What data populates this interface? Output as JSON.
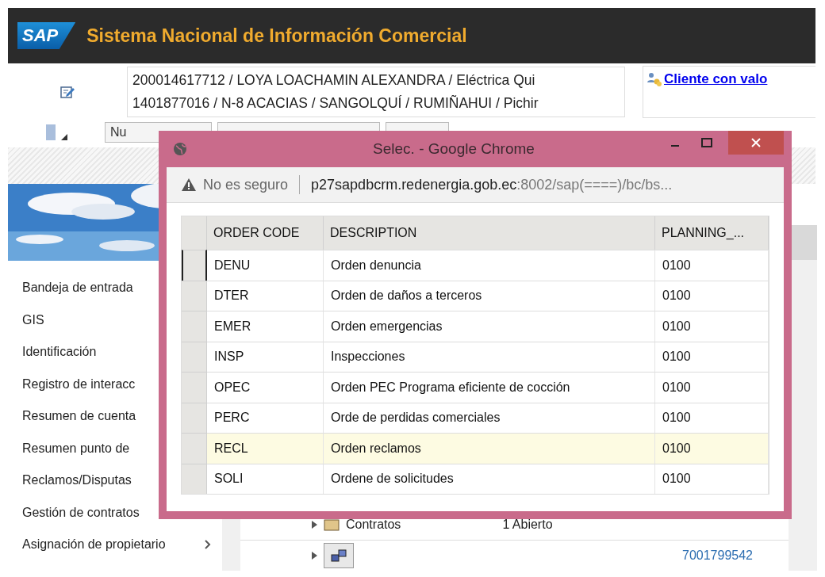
{
  "header": {
    "logo": "SAP",
    "title": "Sistema Nacional de Información Comercial"
  },
  "customer": {
    "lines": [
      "200014617712 / LOYA LOACHAMIN ALEXANDRA / Eléctrica Qui",
      "1401877016 / N-8 ACACIAS / SANGOLQUÍ / RUMIÑAHUI / Pichir"
    ],
    "link": "Cliente con valo"
  },
  "toolbar": {
    "field": "Nu"
  },
  "nav": {
    "items": [
      {
        "label": "Bandeja de entrada"
      },
      {
        "label": "GIS"
      },
      {
        "label": "Identificación"
      },
      {
        "label": "Registro de interacc"
      },
      {
        "label": "Resumen de cuenta"
      },
      {
        "label": "Resumen punto de"
      },
      {
        "label": "Reclamos/Disputas"
      },
      {
        "label": "Gestión de contratos"
      },
      {
        "label": "Asignación de propietario",
        "has_submenu": true
      }
    ]
  },
  "detail": {
    "rows": [
      {
        "kind": "folder",
        "label": "Contratos",
        "status": "1 Abierto"
      },
      {
        "kind": "object",
        "link": "7001799542"
      }
    ]
  },
  "popup": {
    "title": "Selec. - Google Chrome",
    "security": "No es seguro",
    "url_host": "p27sapdbcrm.redenergia.gob.ec",
    "url_rest": ":8002/sap(====)/bc/bs...",
    "table": {
      "columns": [
        "ORDER CODE",
        "DESCRIPTION",
        "PLANNING_..."
      ],
      "rows": [
        {
          "code": "DENU",
          "description": "Orden denuncia",
          "planning": "0100",
          "selected": false,
          "focused": true
        },
        {
          "code": "DTER",
          "description": "Orden de daños a terceros",
          "planning": "0100",
          "selected": false,
          "focused": false
        },
        {
          "code": "EMER",
          "description": "Orden emergencias",
          "planning": "0100",
          "selected": false,
          "focused": false
        },
        {
          "code": "INSP",
          "description": "Inspecciones",
          "planning": "0100",
          "selected": false,
          "focused": false
        },
        {
          "code": "OPEC",
          "description": "Orden PEC Programa eficiente de cocción",
          "planning": "0100",
          "selected": false,
          "focused": false
        },
        {
          "code": "PERC",
          "description": "Orde de perdidas comerciales",
          "planning": "0100",
          "selected": false,
          "focused": false
        },
        {
          "code": "RECL",
          "description": "Orden reclamos",
          "planning": "0100",
          "selected": true,
          "focused": false
        },
        {
          "code": "SOLI",
          "description": "Ordene de solicitudes",
          "planning": "0100",
          "selected": false,
          "focused": false
        }
      ]
    }
  }
}
